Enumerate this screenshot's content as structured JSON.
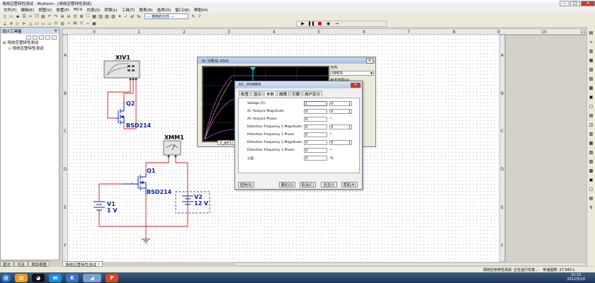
{
  "window": {
    "title": "场效应管特性测试 - Multisim - [场效应管特性测试]"
  },
  "menu": [
    "文件(F)",
    "编辑(E)",
    "视图(V)",
    "放置(P)",
    "MCU",
    "仿真(S)",
    "转换(L)",
    "工具(T)",
    "报表(R)",
    "选项(O)",
    "窗口(W)",
    "帮助(H)"
  ],
  "toolbar": {
    "in_use_combo": "--- 使用的元件 ---"
  },
  "sidebar": {
    "title": "设计工具箱",
    "root": "场效应管特性测试",
    "child": "场效应管特性测试",
    "tabs": [
      "层次",
      "可见",
      "项目视图"
    ]
  },
  "ruler": {
    "cols": [
      "0",
      "1",
      "2",
      "3",
      "4",
      "5",
      "6",
      "7",
      "8",
      "9",
      "10",
      "11"
    ],
    "rows": [
      "A",
      "B",
      "C",
      "D",
      "E",
      "F",
      "G",
      "H"
    ]
  },
  "schematic": {
    "xiv_label": "XIV1",
    "q2_label": "Q2",
    "q2_part": "BSD214",
    "xmm_label": "XMM1",
    "q1_label": "Q1",
    "q1_part": "BSD214",
    "v1_label": "V1",
    "v1_value": "1 V",
    "v2_label": "V2",
    "v2_value": "12 V"
  },
  "iv_window": {
    "title": "IV 分析仪-XIV1",
    "component_label": "元件:",
    "component_value": "NMOS",
    "range_label": "电流范围(A)",
    "cursor_readout": "V_ge(1)"
  },
  "dc_dialog": {
    "title": "DC_POWER",
    "tabs": [
      "标签",
      "显示",
      "参数",
      "故障",
      "引脚",
      "用户定义"
    ],
    "active_tab": "参数",
    "rows": [
      {
        "label": "Voltage (V):",
        "value": "1",
        "unit": "V"
      },
      {
        "label": "AC Analysis Magnitude:",
        "value": "0",
        "unit": "V"
      },
      {
        "label": "AC Analysis Phase:",
        "value": "0",
        "unit": "°"
      },
      {
        "label": "Distortion Frequency 1 Magnitude:",
        "value": "0",
        "unit": "V"
      },
      {
        "label": "Distortion Frequency 1 Phase:",
        "value": "0",
        "unit": "°"
      },
      {
        "label": "Distortion Frequency 2 Magnitude:",
        "value": "0",
        "unit": "V"
      },
      {
        "label": "Distortion Frequency 2 Phase:",
        "value": "0",
        "unit": "°"
      },
      {
        "label": "公差:",
        "value": "0",
        "unit": "%"
      }
    ],
    "buttons": {
      "replace": "替换(R)",
      "ok": "确定(O)",
      "cancel": "取消(C)",
      "info": "信息(I)",
      "help": "帮助(H)"
    }
  },
  "doc_tab": "场效应管特性测试 *",
  "status": {
    "doc": "场效应管特性测试: 正在运行仿真…",
    "time": "传递函数: 27.943 s"
  },
  "clock": {
    "time": "10:15",
    "date": "2012/5/10"
  },
  "colors": {
    "wire": "#d62020",
    "component": "#0a20b0",
    "trace": "#c040e0",
    "cursor": "#00e0e0"
  }
}
